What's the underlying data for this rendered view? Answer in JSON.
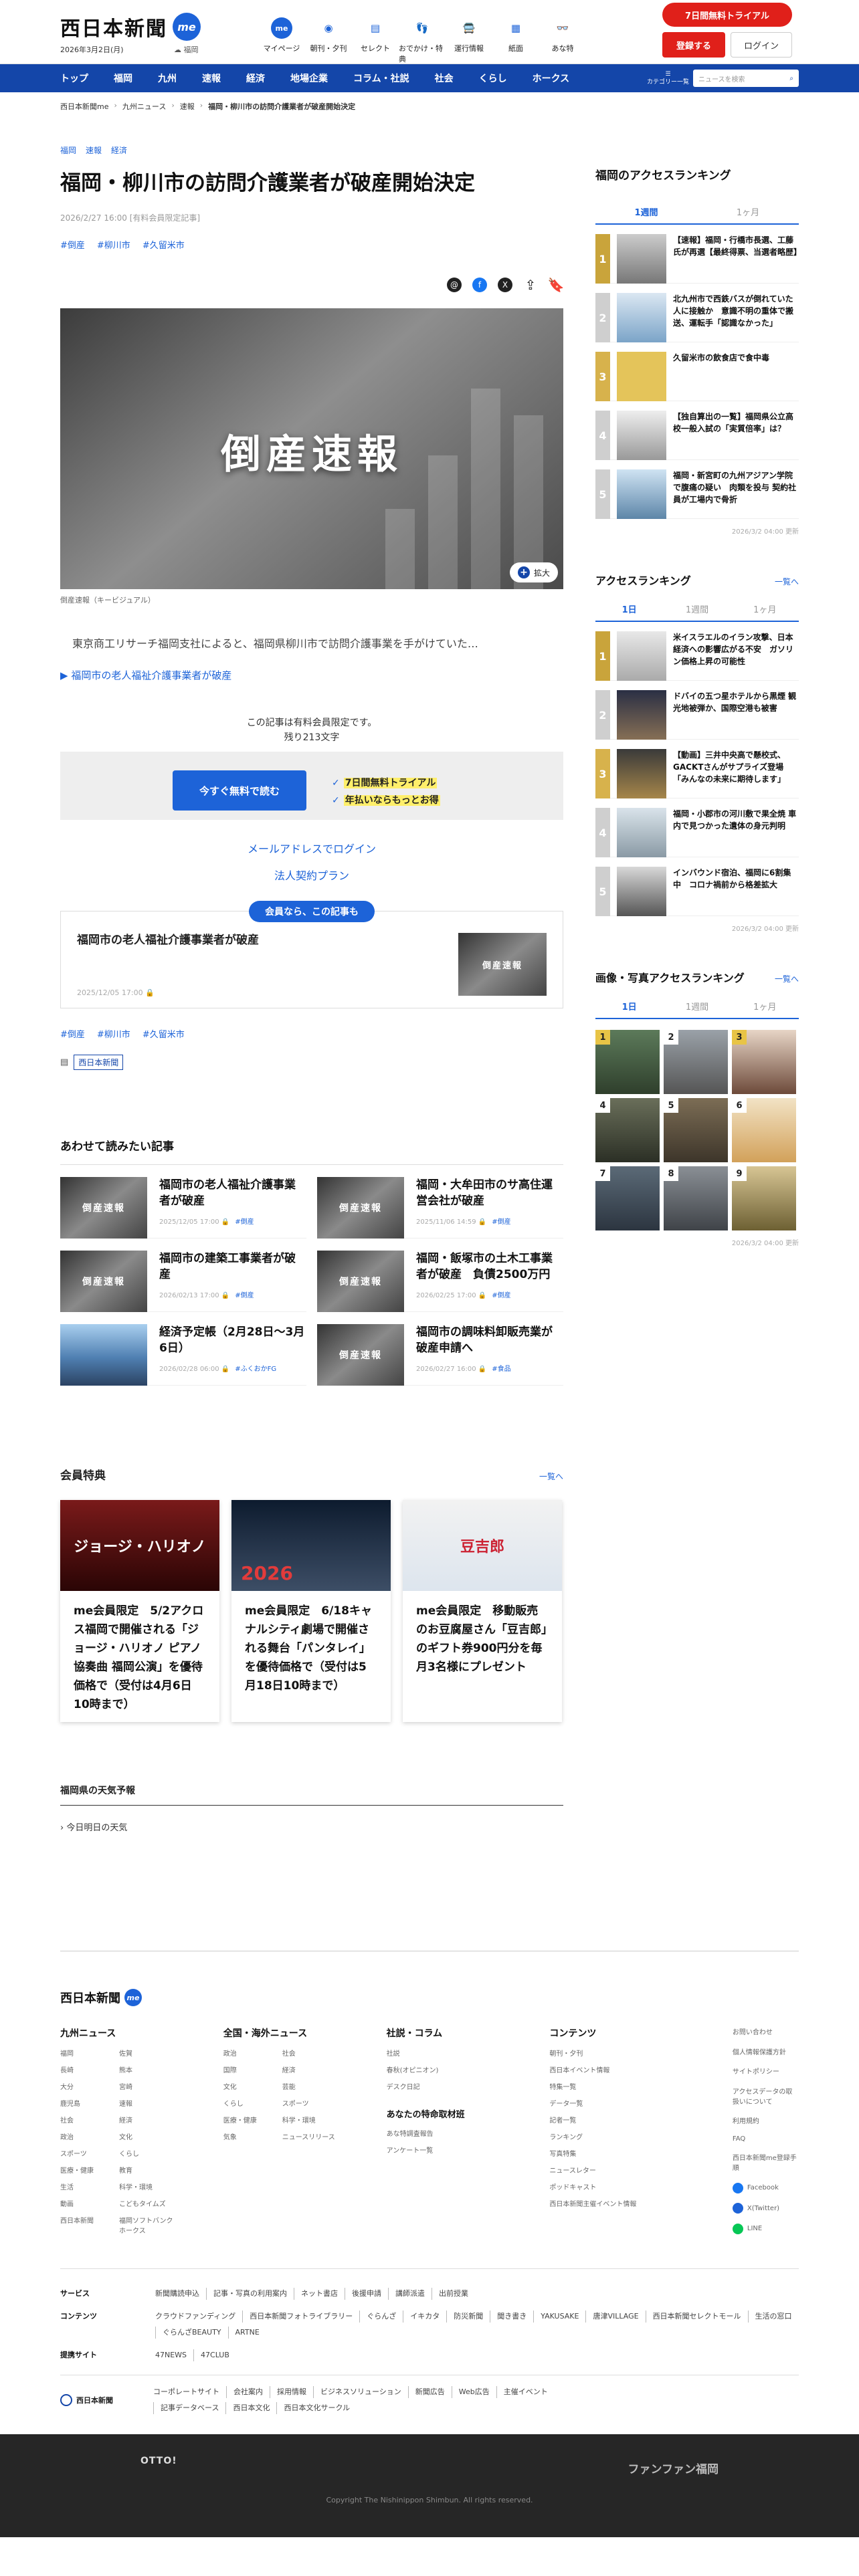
{
  "header": {
    "logo": "西日本新聞",
    "me": "me",
    "date": "2026年3月2日(月)",
    "location": "福岡",
    "icons": [
      {
        "label": "マイページ",
        "icon": "me"
      },
      {
        "label": "朝刊・夕刊",
        "icon": "◉"
      },
      {
        "label": "セレクト",
        "icon": "▤"
      },
      {
        "label": "おでかけ・特典",
        "icon": "👣"
      },
      {
        "label": "運行情報",
        "icon": "🚍"
      },
      {
        "label": "紙面",
        "icon": "▦"
      },
      {
        "label": "あな特",
        "icon": "👓"
      }
    ],
    "trial": "7日間無料トライアル",
    "register": "登録する",
    "login": "ログイン"
  },
  "nav": {
    "items": [
      "トップ",
      "福岡",
      "九州",
      "速報",
      "経済",
      "地場企業",
      "コラム・社説",
      "社会",
      "くらし",
      "ホークス"
    ],
    "category": "カテゴリー一覧",
    "search_placeholder": "ニュースを検索"
  },
  "breadcrumb": [
    "西日本新聞me",
    "九州ニュース",
    "速報",
    "福岡・柳川市の訪問介護業者が破産開始決定"
  ],
  "article": {
    "categories": [
      "福岡",
      "速報",
      "経済"
    ],
    "title": "福岡・柳川市の訪問介護業者が破産開始決定",
    "meta": "2026/2/27 16:00 [有料会員限定記事]",
    "tags": [
      "#倒産",
      "#柳川市",
      "#久留米市"
    ],
    "hero_text": "倒産速報",
    "expand": "拡大",
    "caption": "倒産速報（キービジュアル）",
    "lead": "東京商工リサーチ福岡支社によると、福岡県柳川市で訪問介護事業を手がけていた…",
    "related": "福岡市の老人福祉介護事業者が破産",
    "lock_line1": "この記事は有料会員限定です。",
    "lock_line2": "残り213文字",
    "pay_button": "今すぐ無料で読む",
    "feature1": "7日間無料トライアル",
    "feature2": "年払いならもっとお得",
    "mail_login": "メールアドレスでログイン",
    "corporate": "法人契約プラン",
    "member_pill": "会員なら、この記事も",
    "member_title": "福岡市の老人福祉介護事業者が破産",
    "member_date": "2025/12/05 17:00",
    "tags_bottom": [
      "#倒産",
      "#柳川市",
      "#久留米市"
    ],
    "publisher": "西日本新聞"
  },
  "recommend": {
    "heading": "あわせて読みたい記事",
    "items": [
      {
        "title": "福岡市の老人福祉介護事業者が破産",
        "date": "2025/12/05 17:00",
        "tag": "#倒産",
        "img": "倒産速報"
      },
      {
        "title": "福岡・大牟田市のサ高住運営会社が破産",
        "date": "2025/11/06 14:59",
        "tag": "#倒産",
        "img": "倒産速報"
      },
      {
        "title": "福岡市の建築工事業者が破産",
        "date": "2026/02/13 17:00",
        "tag": "#倒産",
        "img": "倒産速報"
      },
      {
        "title": "福岡・飯塚市の土木工事業者が破産　負債2500万円",
        "date": "2026/02/25 17:00",
        "tag": "#倒産",
        "img": "倒産速報"
      },
      {
        "title": "経済予定帳（2月28日～3月6日）",
        "date": "2026/02/28 06:00",
        "tag": "#ふくおかFG",
        "img": ""
      },
      {
        "title": "福岡市の調味料卸販売業が破産申請へ",
        "date": "2026/02/27 16:00",
        "tag": "#食品",
        "img": "倒産速報"
      }
    ]
  },
  "benefits": {
    "heading": "会員特典",
    "more": "一覧へ",
    "items": [
      {
        "title": "me会員限定　5/2アクロス福岡で開催される「ジョージ・ハリオノ ピアノ協奏曲 福岡公演」を優待価格で（受付は4月6日10時まで）",
        "img": "ジョージ・ハリオノ"
      },
      {
        "title": "me会員限定　6/18キャナルシティ劇場で開催される舞台「パンタレイ」を優待価格で（受付は5月18日10時まで）",
        "img": "2026"
      },
      {
        "title": "me会員限定　移動販売のお豆腐屋さん「豆吉郎」のギフト券900円分を毎月3名様にプレゼント",
        "img": "豆吉郎"
      }
    ]
  },
  "weather": {
    "heading": "福岡県の天気予報",
    "item": "今日明日の天気"
  },
  "sidebar": {
    "access_heading": "福岡のアクセスランキング",
    "tabs1": [
      "1週間",
      "1ヶ月"
    ],
    "ranking1": [
      {
        "rank": "1",
        "title": "【速報】福岡・行橋市長選、工藤氏が再選【最終得票、当選者略歴】"
      },
      {
        "rank": "2",
        "title": "北九州市で西鉄バスが倒れていた人に接触か　意識不明の重体で搬送、運転手「認識なかった」"
      },
      {
        "rank": "3",
        "title": "久留米市の飲食店で食中毒"
      },
      {
        "rank": "4",
        "title": "【独自算出の一覧】福岡県公立高校一般入試の「実質倍率」は？"
      },
      {
        "rank": "5",
        "title": "福岡・新宮町の九州アジアン学院で腹痛の疑い　肉類を投与 契約社員が工場内で骨折"
      }
    ],
    "updated1": "2026/3/2 04:00 更新",
    "access2_heading": "アクセスランキング",
    "more": "一覧へ",
    "tabs2": [
      "1日",
      "1週間",
      "1ヶ月"
    ],
    "ranking2": [
      {
        "rank": "1",
        "title": "米イスラエルのイラン攻撃、日本経済への影響広がる不安　ガソリン価格上昇の可能性"
      },
      {
        "rank": "2",
        "title": "ドバイの五つ星ホテルから黒煙 観光地被弾か、国際空港も被害"
      },
      {
        "rank": "3",
        "title": "【動画】三井中央高で懸校式、GACKTさんがサプライズ登場「みんなの未来に期待します」"
      },
      {
        "rank": "4",
        "title": "福岡・小郡市の河川敷で果全焼 車内で見つかった遺体の身元判明"
      },
      {
        "rank": "5",
        "title": "インバウンド宿泊、福岡に6割集中　コロナ禍前から格差拡大"
      }
    ],
    "updated2": "2026/3/2 04:00 更新",
    "photo_heading": "画像・写真アクセスランキング",
    "tabs3": [
      "1日",
      "1週間",
      "1ヶ月"
    ],
    "photos": [
      "1",
      "2",
      "3",
      "4",
      "5",
      "6",
      "7",
      "8",
      "9"
    ],
    "updated3": "2026/3/2 04:00 更新"
  },
  "footer": {
    "logo": "西日本新聞",
    "col1": {
      "heading": "九州ニュース",
      "items": [
        "福岡",
        "佐賀",
        "長崎",
        "熊本",
        "大分",
        "宮崎",
        "鹿児島",
        "速報",
        "社会",
        "経済",
        "政治",
        "文化",
        "スポーツ",
        "くらし",
        "医療・健康",
        "教育",
        "生活",
        "科学・環境",
        "動画",
        "こどもタイムズ",
        "西日本新聞",
        "福岡ソフトバンクホークス"
      ]
    },
    "col2": {
      "heading": "全国・海外ニュース",
      "items": [
        "政治",
        "社会",
        "国際",
        "経済",
        "文化",
        "芸能",
        "くらし",
        "スポーツ",
        "医療・健康",
        "科学・環境",
        "気象",
        "ニュースリリース"
      ]
    },
    "col3": {
      "heading": "社説・コラム",
      "items": [
        "社説",
        "春秋(オピニオン)",
        "デスク日記"
      ],
      "sub_heading": "あなたの特命取材班",
      "sub_items": [
        "あな特調査報告",
        "アンケート一覧"
      ]
    },
    "col4": {
      "heading": "コンテンツ",
      "items": [
        "朝刊・夕刊",
        "西日本イベント情報",
        "特集一覧",
        "データ一覧",
        "記者一覧",
        "ランキング",
        "写真特集",
        "ニュースレター",
        "ポッドキャスト",
        "西日本新聞主催イベント情報"
      ]
    },
    "col5": [
      "お問い合わせ",
      "個人情報保護方針",
      "サイトポリシー",
      "アクセスデータの取扱いについて",
      "利用規約",
      "FAQ",
      "西日本新聞me登録手順"
    ],
    "sns": [
      "Facebook",
      "X(Twitter)",
      "LINE"
    ],
    "services_label": "サービス",
    "services": [
      "新聞購読申込",
      "記事・写真の利用案内",
      "ネット書店",
      "後援申請",
      "講師派遣",
      "出前授業"
    ],
    "contents_label": "コンテンツ",
    "contents": [
      "クラウドファンディング",
      "西日本新聞フォトライブラリー",
      "ぐらんざ",
      "イキカタ",
      "防災新聞",
      "聞き書き",
      "YAKUSAKE",
      "唐津VILLAGE",
      "西日本新聞セレクトモール",
      "生活の窓口",
      "ぐらんざBEAUTY",
      "ARTNE"
    ],
    "sites_label": "提携サイト",
    "sites": [
      "47NEWS",
      "47CLUB"
    ],
    "corp_label": "西日本新聞",
    "corp_links": [
      "コーポレートサイト",
      "会社案内",
      "採用情報",
      "ビジネスソリューション",
      "新聞広告",
      "Web広告",
      "主催イベント",
      "記事データベース",
      "西日本文化",
      "西日本文化サークル"
    ],
    "bottom_left": "OTTO!",
    "bottom_right": "ファンファン福岡",
    "copyright": "Copyright The Nishinippon Shimbun. All rights reserved."
  },
  "colors": {
    "brand": "#1446a9",
    "accent": "#1d63d8",
    "red": "#e0201a"
  }
}
